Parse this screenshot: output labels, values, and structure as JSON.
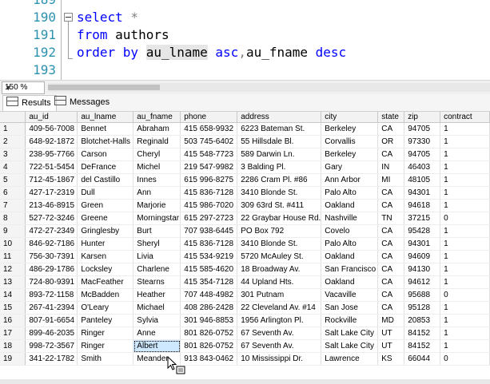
{
  "editor": {
    "lines": [
      {
        "num": "189",
        "parts": []
      },
      {
        "num": "190",
        "parts": [
          {
            "t": "select",
            "c": "kw"
          },
          {
            "t": " *",
            "c": "op"
          }
        ]
      },
      {
        "num": "191",
        "parts": [
          {
            "t": "from",
            "c": "kw"
          },
          {
            "t": " authors",
            "c": "fn"
          }
        ]
      },
      {
        "num": "192",
        "parts": [
          {
            "t": "order by",
            "c": "kw"
          },
          {
            "t": " ",
            "c": "fn"
          },
          {
            "t": "au_lname",
            "c": "fn hl"
          },
          {
            "t": " ",
            "c": "fn"
          },
          {
            "t": "asc",
            "c": "kw"
          },
          {
            "t": ",",
            "c": "op"
          },
          {
            "t": "au_fname",
            "c": "fn"
          },
          {
            "t": " ",
            "c": "fn"
          },
          {
            "t": "desc",
            "c": "kw"
          }
        ]
      },
      {
        "num": "193",
        "parts": []
      }
    ]
  },
  "zoom": {
    "value": "150 %"
  },
  "tabs": {
    "results": "Results",
    "messages": "Messages"
  },
  "grid": {
    "columns": [
      "",
      "au_id",
      "au_lname",
      "au_fname",
      "phone",
      "address",
      "city",
      "state",
      "zip",
      "contract"
    ],
    "rows": [
      [
        "1",
        "409-56-7008",
        "Bennet",
        "Abraham",
        "415 658-9932",
        "6223 Bateman St.",
        "Berkeley",
        "CA",
        "94705",
        "1"
      ],
      [
        "2",
        "648-92-1872",
        "Blotchet-Halls",
        "Reginald",
        "503 745-6402",
        "55 Hillsdale Bl.",
        "Corvallis",
        "OR",
        "97330",
        "1"
      ],
      [
        "3",
        "238-95-7766",
        "Carson",
        "Cheryl",
        "415 548-7723",
        "589 Darwin Ln.",
        "Berkeley",
        "CA",
        "94705",
        "1"
      ],
      [
        "4",
        "722-51-5454",
        "DeFrance",
        "Michel",
        "219 547-9982",
        "3 Balding Pl.",
        "Gary",
        "IN",
        "46403",
        "1"
      ],
      [
        "5",
        "712-45-1867",
        "del Castillo",
        "Innes",
        "615 996-8275",
        "2286 Cram Pl. #86",
        "Ann Arbor",
        "MI",
        "48105",
        "1"
      ],
      [
        "6",
        "427-17-2319",
        "Dull",
        "Ann",
        "415 836-7128",
        "3410 Blonde St.",
        "Palo Alto",
        "CA",
        "94301",
        "1"
      ],
      [
        "7",
        "213-46-8915",
        "Green",
        "Marjorie",
        "415 986-7020",
        "309 63rd St. #411",
        "Oakland",
        "CA",
        "94618",
        "1"
      ],
      [
        "8",
        "527-72-3246",
        "Greene",
        "Morningstar",
        "615 297-2723",
        "22 Graybar House Rd.",
        "Nashville",
        "TN",
        "37215",
        "0"
      ],
      [
        "9",
        "472-27-2349",
        "Gringlesby",
        "Burt",
        "707 938-6445",
        "PO Box 792",
        "Covelo",
        "CA",
        "95428",
        "1"
      ],
      [
        "10",
        "846-92-7186",
        "Hunter",
        "Sheryl",
        "415 836-7128",
        "3410 Blonde St.",
        "Palo Alto",
        "CA",
        "94301",
        "1"
      ],
      [
        "11",
        "756-30-7391",
        "Karsen",
        "Livia",
        "415 534-9219",
        "5720 McAuley St.",
        "Oakland",
        "CA",
        "94609",
        "1"
      ],
      [
        "12",
        "486-29-1786",
        "Locksley",
        "Charlene",
        "415 585-4620",
        "18 Broadway Av.",
        "San Francisco",
        "CA",
        "94130",
        "1"
      ],
      [
        "13",
        "724-80-9391",
        "MacFeather",
        "Stearns",
        "415 354-7128",
        "44 Upland Hts.",
        "Oakland",
        "CA",
        "94612",
        "1"
      ],
      [
        "14",
        "893-72-1158",
        "McBadden",
        "Heather",
        "707 448-4982",
        "301 Putnam",
        "Vacaville",
        "CA",
        "95688",
        "0"
      ],
      [
        "15",
        "267-41-2394",
        "O'Leary",
        "Michael",
        "408 286-2428",
        "22 Cleveland Av. #14",
        "San Jose",
        "CA",
        "95128",
        "1"
      ],
      [
        "16",
        "807-91-6654",
        "Panteley",
        "Sylvia",
        "301 946-8853",
        "1956 Arlington Pl.",
        "Rockville",
        "MD",
        "20853",
        "1"
      ],
      [
        "17",
        "899-46-2035",
        "Ringer",
        "Anne",
        "801 826-0752",
        "67 Seventh Av.",
        "Salt Lake City",
        "UT",
        "84152",
        "1"
      ],
      [
        "18",
        "998-72-3567",
        "Ringer",
        "Albert",
        "801 826-0752",
        "67 Seventh Av.",
        "Salt Lake City",
        "UT",
        "84152",
        "1"
      ],
      [
        "19",
        "341-22-1782",
        "Smith",
        "Meander",
        "913 843-0462",
        "10 Mississippi Dr.",
        "Lawrence",
        "KS",
        "66044",
        "0"
      ]
    ],
    "selected": {
      "row": 17,
      "col": 3
    }
  }
}
